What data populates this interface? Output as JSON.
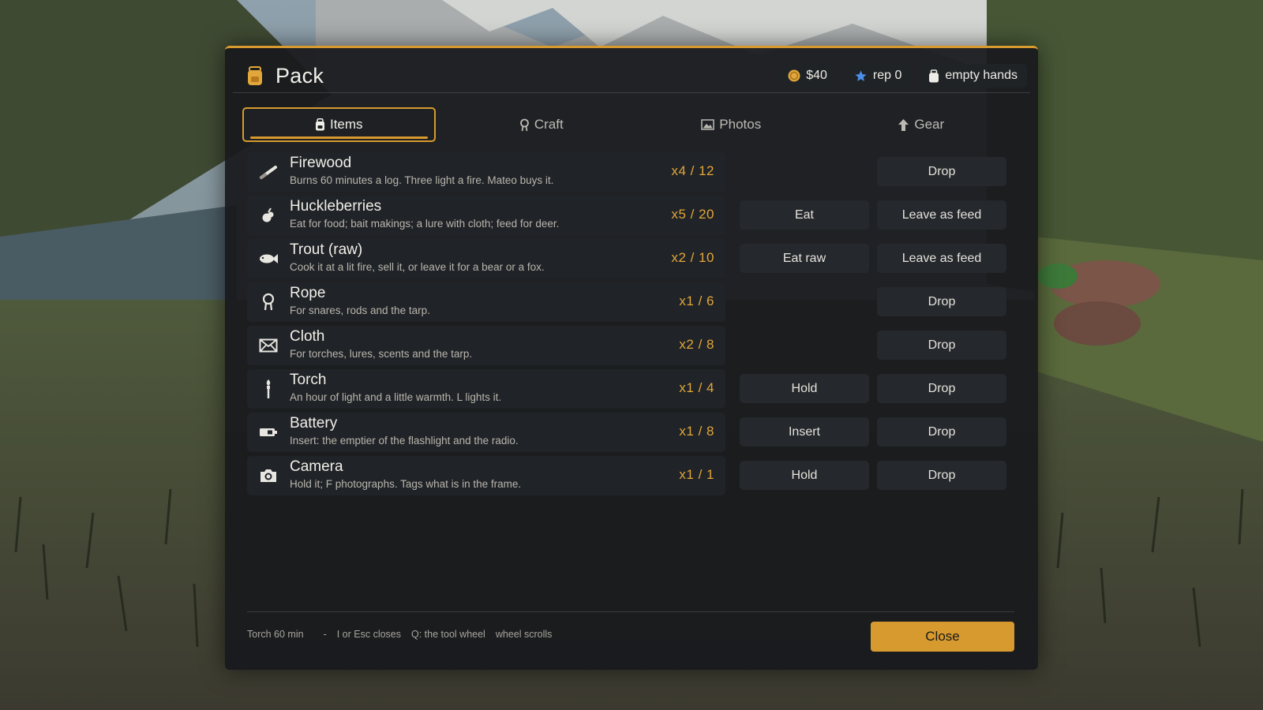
{
  "header": {
    "title": "Pack",
    "money": "$40",
    "rep": "rep 0",
    "hands": "empty hands"
  },
  "tabs": [
    {
      "label": "Items",
      "icon": "bag-icon",
      "active": true
    },
    {
      "label": "Craft",
      "icon": "rope-icon",
      "active": false
    },
    {
      "label": "Photos",
      "icon": "photo-icon",
      "active": false
    },
    {
      "label": "Gear",
      "icon": "arrow-up-icon",
      "active": false
    }
  ],
  "items": [
    {
      "name": "Firewood",
      "desc": "Burns 60 minutes a log. Three light a fire. Mateo buys it.",
      "count": "x4 / 12",
      "action1": "",
      "action2": "Drop",
      "icon": "log-icon"
    },
    {
      "name": "Huckleberries",
      "desc": "Eat for food; bait makings; a lure with cloth; feed for deer.",
      "count": "x5 / 20",
      "action1": "Eat",
      "action2": "Leave as feed",
      "icon": "berry-icon"
    },
    {
      "name": "Trout (raw)",
      "desc": "Cook it at a lit fire, sell it, or leave it for a bear or a fox.",
      "count": "x2 / 10",
      "action1": "Eat raw",
      "action2": "Leave as feed",
      "icon": "fish-icon"
    },
    {
      "name": "Rope",
      "desc": "For snares, rods and the tarp.",
      "count": "x1 / 6",
      "action1": "",
      "action2": "Drop",
      "icon": "rope-icon"
    },
    {
      "name": "Cloth",
      "desc": "For torches, lures, scents and the tarp.",
      "count": "x2 / 8",
      "action1": "",
      "action2": "Drop",
      "icon": "cloth-icon"
    },
    {
      "name": "Torch",
      "desc": "An hour of light and a little warmth. L lights it.",
      "count": "x1 / 4",
      "action1": "Hold",
      "action2": "Drop",
      "icon": "torch-icon"
    },
    {
      "name": "Battery",
      "desc": "Insert: the emptier of the flashlight and the radio.",
      "count": "x1 / 8",
      "action1": "Insert",
      "action2": "Drop",
      "icon": "battery-icon"
    },
    {
      "name": "Camera",
      "desc": "Hold it; F photographs. Tags what is in the frame.",
      "count": "x1 / 1",
      "action1": "Hold",
      "action2": "Drop",
      "icon": "camera-icon"
    }
  ],
  "footer": {
    "hint_torch": "Torch 60 min",
    "hint_sep": "-",
    "hint_close": "I or Esc closes",
    "hint_wheel": "Q: the tool wheel",
    "hint_scroll": "wheel scrolls",
    "close_label": "Close"
  },
  "colors": {
    "accent": "#d79a2e",
    "count": "#e2a73a",
    "panel": "#181a1d",
    "rep_star": "#4a8ee8"
  }
}
